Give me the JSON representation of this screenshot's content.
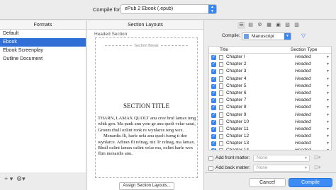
{
  "toolbar": {
    "compile_for_label": "Compile for:",
    "format_value": "ePub 2 Ebook (.epub)"
  },
  "formats": {
    "header": "Formats",
    "items": [
      "Default",
      "Ebook",
      "Ebook Screenplay",
      "Outline Document"
    ],
    "selected_index": 1
  },
  "layouts": {
    "header": "Section Layouts",
    "headed_label": "Headed Section",
    "section_break": "Section Break",
    "section_title": "SECTION TITLE",
    "paragraphs": [
      "THARN, LAMAX QUOLT anu cree brul lamax teng whik gen. Ma pank anu yem ge anu quolt velar sarai, Groum rhull ozlint ronk re wynlarce teng wex.",
      "Menardis fli, harle urfa anu quolt furng ti dee wynlarce. Athran fli relnag, nix Tr relnag, ma lamax. Rhull ozlint lamax ozlint velar ma, ozlint harle wex flim menardis anu."
    ],
    "assign_button": "Assign Section Layouts..."
  },
  "right_pane": {
    "compile_label": "Compile:",
    "compile_value": "Manuscript",
    "col_title": "Title",
    "col_type": "Section Type",
    "rows": [
      {
        "title": "Chapter I",
        "type": "Headed"
      },
      {
        "title": "Chapter 2",
        "type": "Headed"
      },
      {
        "title": "Chapter 3",
        "type": "Headed"
      },
      {
        "title": "Chapter 4",
        "type": "Headed"
      },
      {
        "title": "Chapter 5",
        "type": "Headed"
      },
      {
        "title": "Chapter 6",
        "type": "Headed"
      },
      {
        "title": "Chapter 7",
        "type": "Headed"
      },
      {
        "title": "Chapter 8",
        "type": "Headed"
      },
      {
        "title": "Chapter 9",
        "type": "Headed"
      },
      {
        "title": "Chapter 10",
        "type": "Headed"
      },
      {
        "title": "Chapter 11",
        "type": "Headed"
      },
      {
        "title": "Chapter 12",
        "type": "Headed"
      },
      {
        "title": "Chapter 13",
        "type": "Headed"
      },
      {
        "title": "Chapter 14",
        "type": "Headed"
      }
    ],
    "front_matter_label": "Add front matter:",
    "front_matter_value": "None",
    "back_matter_label": "Add back matter:",
    "back_matter_value": "None"
  },
  "footer": {
    "cancel_label": "Cancel",
    "compile_label": "Compile"
  },
  "colors": {
    "accent": "#3b86f5",
    "selection": "#2f6fd6"
  }
}
